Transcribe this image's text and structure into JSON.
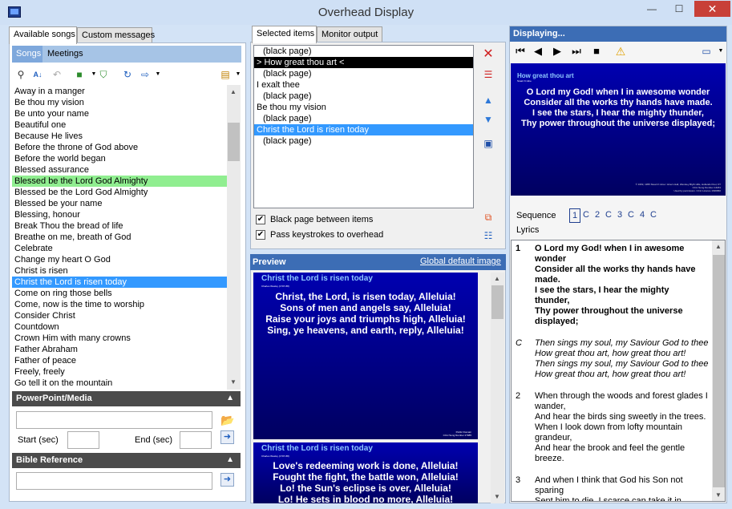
{
  "window": {
    "title": "Overhead Display",
    "minimize": "—",
    "maximize": "☐",
    "close": "✕"
  },
  "left": {
    "tabs": [
      "Available songs",
      "Custom messages"
    ],
    "subtabs": [
      "Songs",
      "Meetings"
    ],
    "songs": [
      "Away in a manger",
      "Be thou my vision",
      "Be unto your name",
      "Beautiful one",
      "Because He lives",
      "Before the throne of God above",
      "Before the world began",
      "Blessed assurance",
      "Blessed be the Lord God Almighty",
      "Blessed be the Lord God Almighty",
      "Blessed be your name",
      "Blessing, honour",
      "Break Thou the bread of life",
      "Breathe on me, breath of God",
      "Celebrate",
      "Change my heart O God",
      "Christ is risen",
      "Christ the Lord is risen today",
      "Come on ring those bells",
      "Come, now is the time to worship",
      "Consider Christ",
      "Countdown",
      "Crown Him with many crowns",
      "Father Abraham",
      "Father of peace",
      "Freely, freely",
      "Go tell it on the mountain"
    ],
    "powerpoint": {
      "header": "PowerPoint/Media",
      "start_label": "Start (sec)",
      "end_label": "End (sec)"
    },
    "bible": {
      "header": "Bible Reference"
    }
  },
  "middle": {
    "tabs": [
      "Selected items",
      "Monitor output"
    ],
    "items": [
      "(black page)",
      "> How great thou art <",
      "(black page)",
      "I exalt thee",
      "(black page)",
      "Be thou my vision",
      "(black page)",
      "Christ the Lord is risen today",
      "(black page)"
    ],
    "checkboxes": [
      {
        "label": "Black page between items",
        "checked": true
      },
      {
        "label": "Pass keystrokes to overhead",
        "checked": true
      }
    ],
    "preview": {
      "header": "Preview",
      "link": "Global default image"
    },
    "slides": [
      {
        "title": "Christ the Lord is risen today",
        "credit": "Charles Wesley (1707-88)",
        "lines": [
          "Christ, the Lord, is risen today, Alleluia!",
          "Sons of men and angels say, Alleluia!",
          "Raise your joys and triumphs high, Alleluia!",
          "Sing, ye heavens, and earth, reply, Alleluia!"
        ],
        "footer": "Public Domain\nCCLI Song Number 27985"
      },
      {
        "title": "Christ the Lord is risen today",
        "credit": "Charles Wesley (1707-88)",
        "lines": [
          "Love's redeeming work is done, Alleluia!",
          "Fought the fight, the battle won, Alleluia!",
          "Lo! the Sun's eclipse is over, Alleluia!",
          "Lo! He sets in blood no more, Alleluia!"
        ],
        "footer": ""
      }
    ]
  },
  "right": {
    "header": "Displaying...",
    "display": {
      "title": "How great thou art",
      "credit": "Stuart K Hine",
      "lines": [
        "O Lord my God! when I in awesome wonder",
        "Consider all the works thy hands have made.",
        "I see the stars, I hear the mighty thunder,",
        "Thy power throughout the universe displayed;"
      ],
      "footer": "© 1953, 1955 Stuart K Hine / Hine's Hall, Wensley Blyth Hills, Hollands Pool, KT\nCCLI Song Number 14181\nUsed by permission. CCLI Licence 1636860"
    },
    "sequence_label": "Sequence",
    "sequence": [
      "1",
      "C",
      "2",
      "C",
      "3",
      "C",
      "4",
      "C"
    ],
    "lyrics_label": "Lyrics",
    "lyrics": [
      {
        "num": "1",
        "bold": true,
        "italic": false,
        "lines": [
          "O Lord my God! when I in awesome",
          "wonder",
          "Consider all the works thy hands have",
          "made.",
          "I see the stars, I hear the mighty",
          "thunder,",
          "Thy power throughout the universe",
          "displayed;"
        ]
      },
      {
        "num": "C",
        "bold": false,
        "italic": true,
        "lines": [
          "Then sings my soul, my Saviour God to thee",
          "How great thou art, how great thou art!",
          "Then sings my soul, my Saviour God to thee",
          "How great thou art, how great thou art!"
        ]
      },
      {
        "num": "2",
        "bold": false,
        "italic": false,
        "lines": [
          "When through the woods and forest glades I",
          "wander,",
          "And hear the birds sing sweetly in the trees.",
          "When I look down from lofty mountain",
          "grandeur,",
          "And hear the brook and feel the gentle",
          "breeze."
        ]
      },
      {
        "num": "3",
        "bold": false,
        "italic": false,
        "lines": [
          "And when I think that God his Son not",
          "sparing",
          "Sent him to die, I scarce can take it in"
        ]
      }
    ]
  },
  "colors": {
    "selection": "#3399ff",
    "highlight_green": "#90ee90",
    "slide_bg": "#0000b0",
    "section_header": "#4b4b4b",
    "preview_header": "#3c6db5"
  }
}
